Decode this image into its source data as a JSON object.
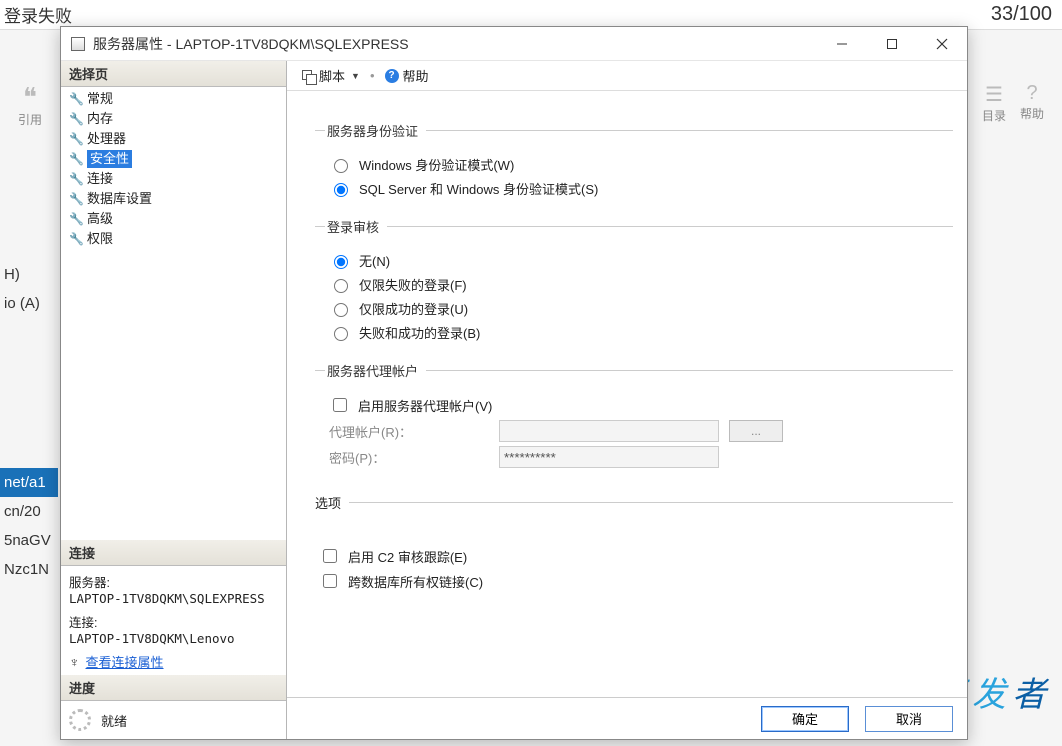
{
  "background": {
    "top_text": "登录失败",
    "page_counter": "33/100",
    "quote_label": "引用",
    "toc_label": "目录",
    "help_label": "帮助",
    "left_items": [
      "H)",
      "io (A)",
      "net/a1",
      "cn/20",
      "5naGV",
      "Nzc1N"
    ],
    "logo_a": "开发",
    "logo_b": "者"
  },
  "dialog": {
    "title": "服务器属性 - LAPTOP-1TV8DQKM\\SQLEXPRESS"
  },
  "left": {
    "select_page": "选择页",
    "pages": [
      "常规",
      "内存",
      "处理器",
      "安全性",
      "连接",
      "数据库设置",
      "高级",
      "权限"
    ],
    "selected_index": 3,
    "connection_header": "连接",
    "server_label": "服务器:",
    "server_value": "LAPTOP-1TV8DQKM\\SQLEXPRESS",
    "conn_label": "连接:",
    "conn_value": "LAPTOP-1TV8DQKM\\Lenovo",
    "view_conn_link": "查看连接属性",
    "progress_header": "进度",
    "ready": "就绪"
  },
  "toolbar": {
    "script": "脚本",
    "help": "帮助"
  },
  "auth": {
    "legend": "服务器身份验证",
    "opt_windows": "Windows 身份验证模式(W)",
    "opt_mixed": "SQL Server 和 Windows 身份验证模式(S)",
    "selected": "mixed"
  },
  "audit": {
    "legend": "登录审核",
    "opt_none": "无(N)",
    "opt_failed": "仅限失败的登录(F)",
    "opt_success": "仅限成功的登录(U)",
    "opt_both": "失败和成功的登录(B)",
    "selected": "none"
  },
  "proxy": {
    "legend": "服务器代理帐户",
    "enable": "启用服务器代理帐户(V)",
    "account_label": "代理帐户(R)：",
    "account_value": "",
    "password_label": "密码(P)：",
    "password_value": "**********",
    "browse": "..."
  },
  "options": {
    "legend": "选项",
    "c2": "启用 C2 审核跟踪(E)",
    "crossdb": "跨数据库所有权链接(C)"
  },
  "buttons": {
    "ok": "确定",
    "cancel": "取消"
  }
}
